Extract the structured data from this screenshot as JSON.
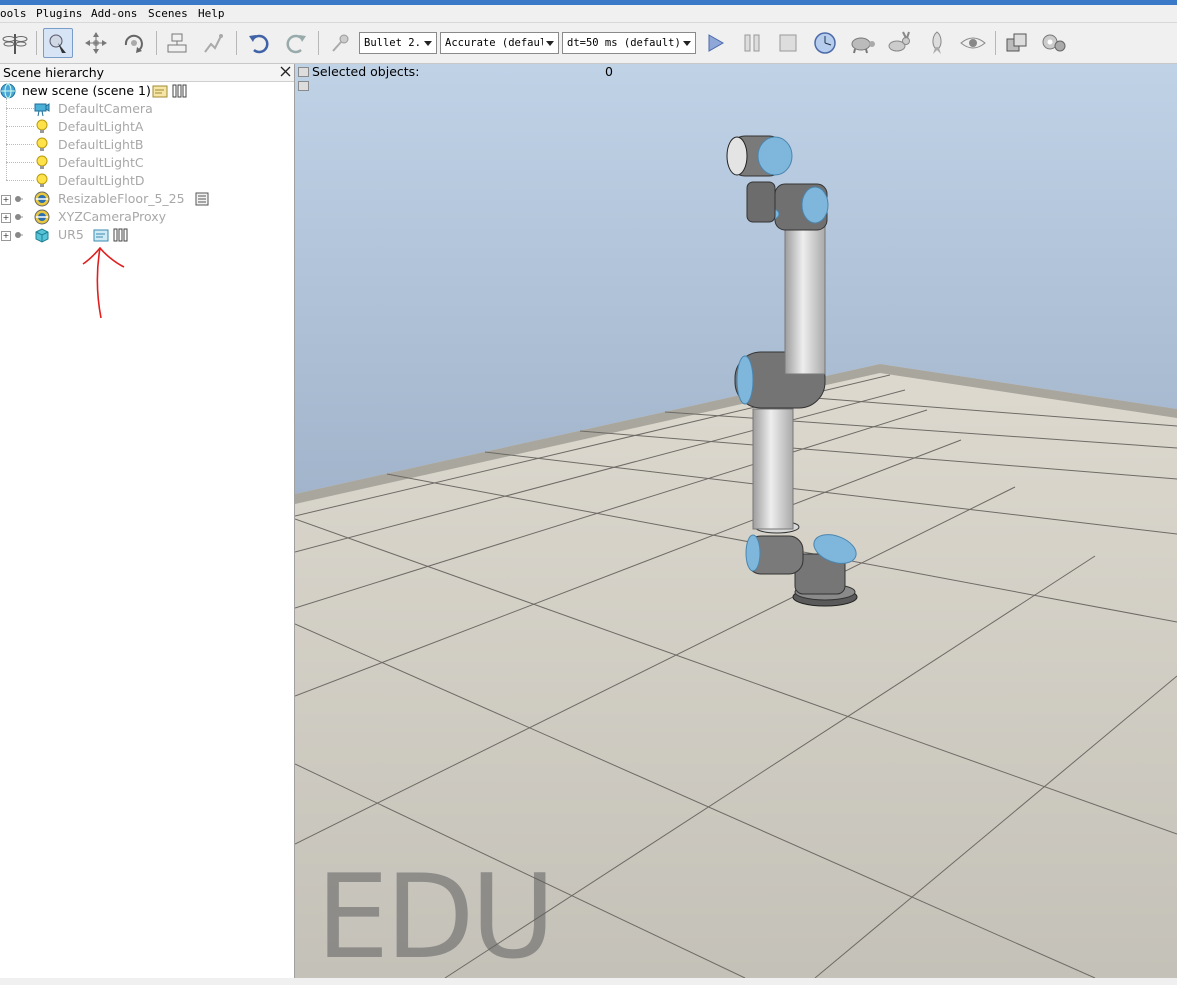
{
  "menubar": {
    "items": [
      "ools",
      "Plugins",
      "Add-ons",
      "Scenes",
      "Help"
    ]
  },
  "toolbar": {
    "engine": "Bullet 2.",
    "accuracy": "Accurate (defaul",
    "timestep": "dt=50 ms (default)",
    "icons": [
      "dragonfly-icon",
      "pointer-icon",
      "move-icon",
      "rotate-icon",
      "assemble-icon",
      "disassemble-icon",
      "undo-icon",
      "redo-icon",
      "probe-icon",
      "play-icon",
      "pause-icon",
      "stop-icon",
      "realtime-icon",
      "turtle-icon",
      "rabbit-icon",
      "rocket-icon",
      "eye-icon",
      "layers-icon",
      "gears-icon"
    ]
  },
  "panel": {
    "title": "Scene hierarchy"
  },
  "tree": {
    "root": "new scene (scene 1)",
    "items": [
      "DefaultCamera",
      "DefaultLightA",
      "DefaultLightB",
      "DefaultLightC",
      "DefaultLightD",
      "ResizableFloor_5_25",
      "XYZCameraProxy",
      "UR5"
    ]
  },
  "status": {
    "label": "Selected objects:",
    "count": "0"
  },
  "watermark": "EDU",
  "colors": {
    "accent": "#7fb6dc",
    "annotation": "#e02020",
    "floor": "#cfccc4",
    "wall": "#9aaec4"
  }
}
